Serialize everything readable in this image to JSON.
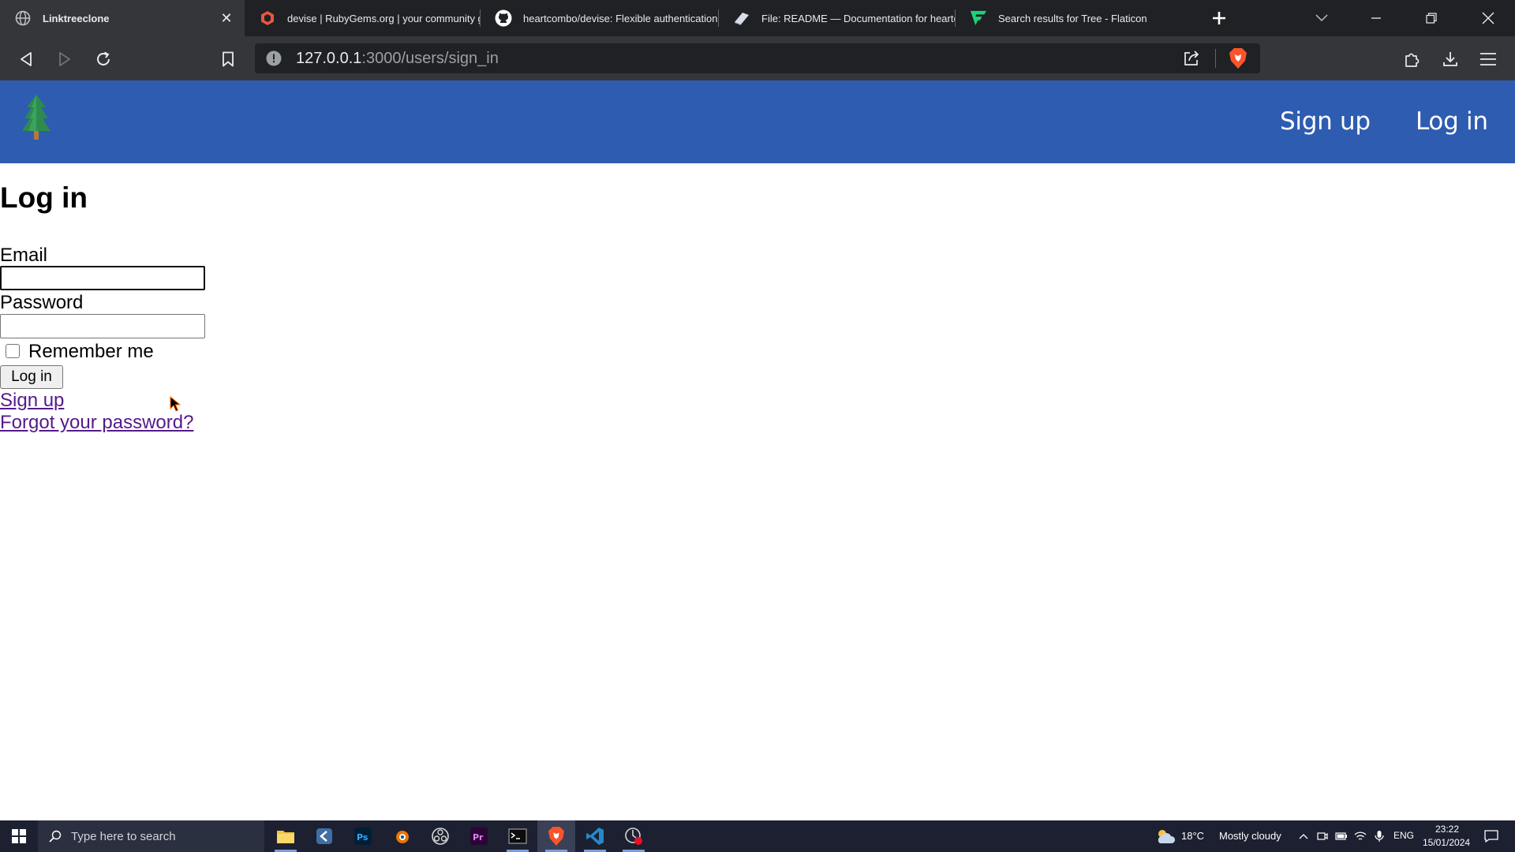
{
  "browser": {
    "tabs": [
      {
        "title": "Linktreeclone",
        "icon": "globe-icon",
        "active": true
      },
      {
        "title": "devise | RubyGems.org | your community gem",
        "icon": "rubygems-icon",
        "active": false
      },
      {
        "title": "heartcombo/devise: Flexible authentication so",
        "icon": "github-icon",
        "active": false
      },
      {
        "title": "File: README — Documentation for heartcom",
        "icon": "rubydoc-icon",
        "active": false
      },
      {
        "title": "Search results for Tree - Flaticon",
        "icon": "flaticon-icon",
        "active": false
      }
    ],
    "url_host": "127.0.0.1",
    "url_rest": ":3000/users/sign_in"
  },
  "navbar": {
    "logo": "tree-icon",
    "sign_up": "Sign up",
    "log_in": "Log in",
    "color": "#2e5cb0"
  },
  "form": {
    "heading": "Log in",
    "email_label": "Email",
    "email_value": "",
    "password_label": "Password",
    "password_value": "",
    "remember_label": "Remember me",
    "remember_checked": false,
    "submit_label": "Log in",
    "sign_up_link": "Sign up",
    "forgot_link": "Forgot your password?"
  },
  "taskbar": {
    "search_placeholder": "Type here to search",
    "apps": [
      "file-explorer-icon",
      "android-studio-icon",
      "photoshop-icon",
      "blender-icon",
      "obs-icon",
      "premiere-icon",
      "terminal-icon",
      "brave-icon",
      "vscode-icon",
      "recorder-icon"
    ],
    "weather_temp": "18°C",
    "weather_text": "Mostly cloudy",
    "language": "ENG",
    "time": "23:22",
    "date": "15/01/2024"
  }
}
